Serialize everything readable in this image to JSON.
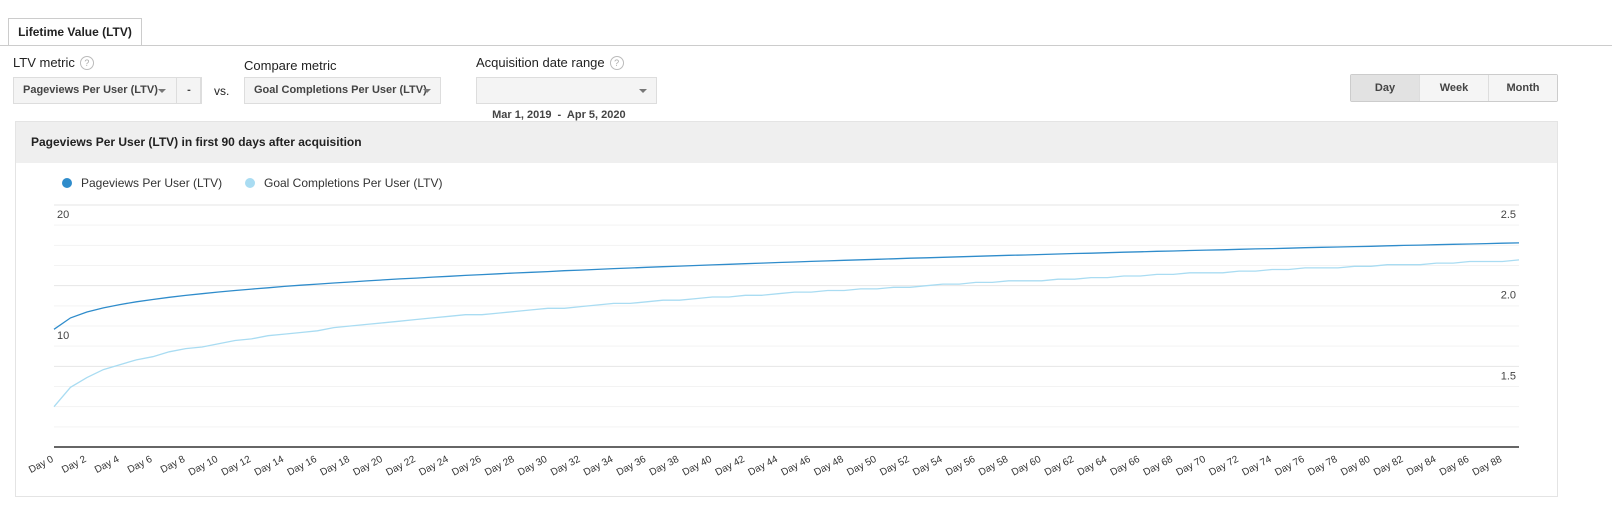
{
  "tab": {
    "label": "Lifetime Value (LTV)"
  },
  "controls": {
    "ltv_metric": {
      "label": "LTV metric",
      "help": "?",
      "value": "Pageviews Per User (LTV)",
      "remove": "-"
    },
    "vs": "vs.",
    "compare_metric": {
      "label": "Compare metric",
      "value": "Goal Completions Per User (LTV)"
    },
    "date_range": {
      "label": "Acquisition date range",
      "help": "?",
      "value": "Mar 1, 2019  -  Apr 5, 2020"
    },
    "granularity": [
      {
        "label": "Day",
        "selected": true
      },
      {
        "label": "Week",
        "selected": false
      },
      {
        "label": "Month",
        "selected": false
      }
    ]
  },
  "panel": {
    "title": "Pageviews Per User (LTV) in first 90 days after acquisition"
  },
  "chart_data": {
    "type": "line",
    "title": "Pageviews Per User (LTV) in first 90 days after acquisition",
    "legend_placement": "top-left",
    "grid": true,
    "x": [
      0,
      1,
      2,
      3,
      4,
      5,
      6,
      7,
      8,
      9,
      10,
      11,
      12,
      13,
      14,
      15,
      16,
      17,
      18,
      19,
      20,
      21,
      22,
      23,
      24,
      25,
      26,
      27,
      28,
      29,
      30,
      31,
      32,
      33,
      34,
      35,
      36,
      37,
      38,
      39,
      40,
      41,
      42,
      43,
      44,
      45,
      46,
      47,
      48,
      49,
      50,
      51,
      52,
      53,
      54,
      55,
      56,
      57,
      58,
      59,
      60,
      61,
      62,
      63,
      64,
      65,
      66,
      67,
      68,
      69,
      70,
      71,
      72,
      73,
      74,
      75,
      76,
      77,
      78,
      79,
      80,
      81,
      82,
      83,
      84,
      85,
      86,
      87,
      88,
      89
    ],
    "x_tick_labels": [
      "Day 0",
      "Day 2",
      "Day 4",
      "Day 6",
      "Day 8",
      "Day 10",
      "Day 12",
      "Day 14",
      "Day 16",
      "Day 18",
      "Day 20",
      "Day 22",
      "Day 24",
      "Day 26",
      "Day 28",
      "Day 30",
      "Day 32",
      "Day 34",
      "Day 36",
      "Day 38",
      "Day 40",
      "Day 42",
      "Day 44",
      "Day 46",
      "Day 48",
      "Day 50",
      "Day 52",
      "Day 54",
      "Day 56",
      "Day 58",
      "Day 60",
      "Day 62",
      "Day 64",
      "Day 66",
      "Day 68",
      "Day 70",
      "Day 72",
      "Day 74",
      "Day 76",
      "Day 78",
      "Day 80",
      "Day 82",
      "Day 84",
      "Day 86",
      "Day 88"
    ],
    "y_left": {
      "range": [
        0,
        20
      ],
      "ticks": [
        "20",
        "10"
      ],
      "tick_values": [
        20,
        10
      ]
    },
    "y_right": {
      "range": [
        1.0,
        2.5
      ],
      "ticks": [
        "2.5",
        "2.0",
        "1.5"
      ],
      "tick_values": [
        2.5,
        2.0,
        1.5
      ]
    },
    "series": [
      {
        "name": "Pageviews Per User (LTV)",
        "axis": "left",
        "color": "#2f8ccb",
        "values": [
          9.73,
          10.67,
          11.16,
          11.5,
          11.77,
          12.0,
          12.19,
          12.37,
          12.53,
          12.67,
          12.81,
          12.93,
          13.05,
          13.16,
          13.27,
          13.37,
          13.46,
          13.55,
          13.64,
          13.73,
          13.81,
          13.89,
          13.96,
          14.04,
          14.11,
          14.18,
          14.25,
          14.31,
          14.38,
          14.44,
          14.5,
          14.57,
          14.62,
          14.68,
          14.74,
          14.79,
          14.85,
          14.9,
          14.95,
          15.0,
          15.05,
          15.1,
          15.15,
          15.2,
          15.25,
          15.29,
          15.34,
          15.38,
          15.43,
          15.47,
          15.51,
          15.55,
          15.6,
          15.64,
          15.68,
          15.72,
          15.76,
          15.8,
          15.84,
          15.87,
          15.91,
          15.95,
          15.99,
          16.02,
          16.06,
          16.1,
          16.13,
          16.17,
          16.2,
          16.24,
          16.27,
          16.3,
          16.34,
          16.37,
          16.4,
          16.43,
          16.47,
          16.5,
          16.53,
          16.56,
          16.59,
          16.63,
          16.66,
          16.69,
          16.72,
          16.75,
          16.78,
          16.81,
          16.84,
          16.87
        ]
      },
      {
        "name": "Goal Completions Per User (LTV)",
        "axis": "right",
        "color": "#a9dcf2",
        "values": [
          1.25,
          1.37,
          1.43,
          1.48,
          1.51,
          1.54,
          1.56,
          1.59,
          1.61,
          1.62,
          1.64,
          1.66,
          1.67,
          1.69,
          1.7,
          1.71,
          1.72,
          1.74,
          1.75,
          1.76,
          1.77,
          1.78,
          1.79,
          1.8,
          1.81,
          1.82,
          1.82,
          1.83,
          1.84,
          1.85,
          1.86,
          1.86,
          1.87,
          1.88,
          1.89,
          1.89,
          1.9,
          1.91,
          1.91,
          1.92,
          1.93,
          1.93,
          1.94,
          1.94,
          1.95,
          1.96,
          1.96,
          1.97,
          1.97,
          1.98,
          1.98,
          1.99,
          1.99,
          2.0,
          2.01,
          2.01,
          2.02,
          2.02,
          2.03,
          2.03,
          2.03,
          2.04,
          2.04,
          2.05,
          2.05,
          2.06,
          2.06,
          2.07,
          2.07,
          2.08,
          2.08,
          2.08,
          2.09,
          2.09,
          2.1,
          2.1,
          2.11,
          2.11,
          2.11,
          2.12,
          2.12,
          2.13,
          2.13,
          2.13,
          2.14,
          2.14,
          2.15,
          2.15,
          2.15,
          2.16
        ]
      }
    ]
  }
}
